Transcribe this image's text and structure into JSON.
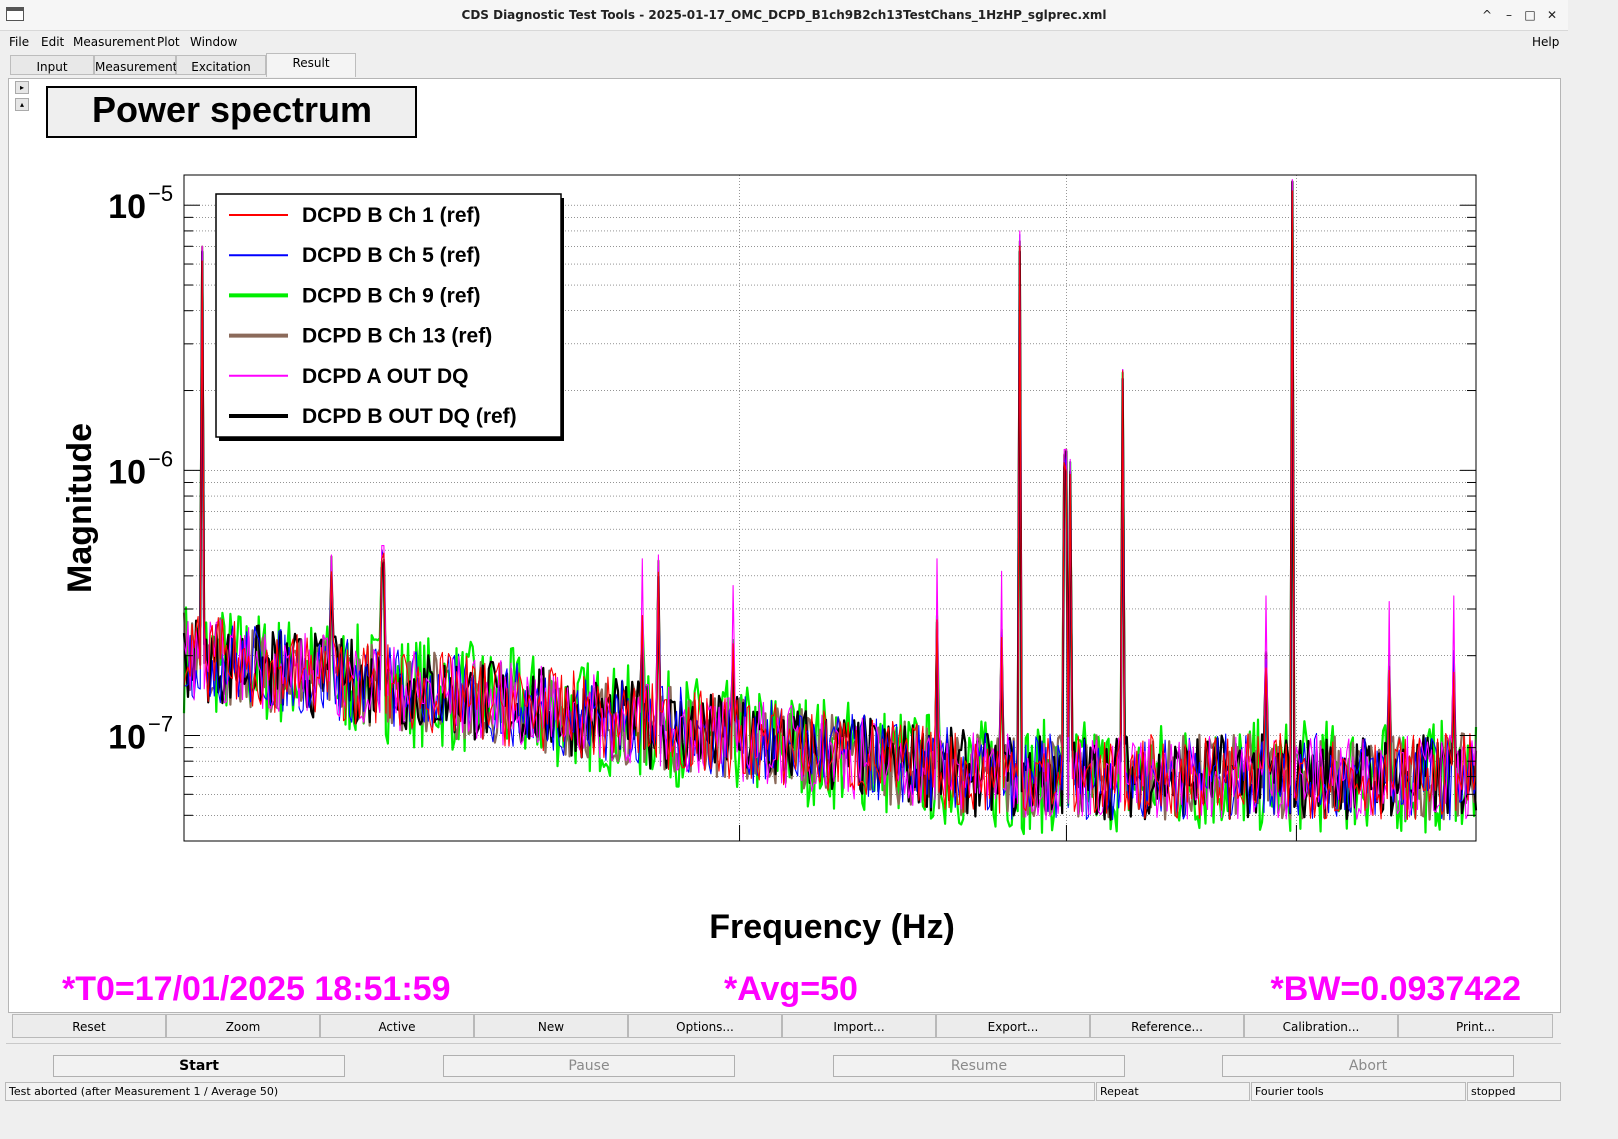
{
  "window": {
    "title": "CDS Diagnostic Test Tools - 2025-01-17_OMC_DCPD_B1ch9B2ch13TestChans_1HzHP_sglprec.xml",
    "controls": [
      "^",
      "–",
      "□",
      "✕"
    ]
  },
  "menu": {
    "items": [
      "File",
      "Edit",
      "Measurement",
      "Plot",
      "Window"
    ],
    "help": "Help"
  },
  "tabs": [
    {
      "label": "Input",
      "active": false
    },
    {
      "label": "Measurement",
      "active": false
    },
    {
      "label": "Excitation",
      "active": false
    },
    {
      "label": "Result",
      "active": true
    }
  ],
  "side_buttons": [
    "▸",
    "▴"
  ],
  "plot": {
    "title": "Power spectrum",
    "info": {
      "t0": "*T0=17/01/2025 18:51:59",
      "avg": "*Avg=50",
      "bw": "*BW=0.0937422"
    },
    "colors": {
      "info_text": "#ff00ff",
      "grid": "#555555"
    }
  },
  "chart_data": {
    "type": "line",
    "title": "Power spectrum",
    "xlabel": "Frequency (Hz)",
    "ylabel": "Magnitude",
    "yscale": "log",
    "ylim": [
      4e-08,
      1.3e-05
    ],
    "ytick_labels": [
      {
        "value": 1e-05,
        "mantissa": "10",
        "exp": "−5"
      },
      {
        "value": 1e-06,
        "mantissa": "10",
        "exp": "−6"
      },
      {
        "value": 1e-07,
        "mantissa": "10",
        "exp": "−7"
      }
    ],
    "grid": true,
    "legend_position": "top-left",
    "series": [
      {
        "name": "DCPD B Ch 1 (ref)",
        "color": "#ff0000",
        "style": "thin"
      },
      {
        "name": "DCPD B Ch 5 (ref)",
        "color": "#0000ff",
        "style": "thin"
      },
      {
        "name": "DCPD B Ch 9 (ref)",
        "color": "#00ee00",
        "style": "thick"
      },
      {
        "name": "DCPD B Ch 13 (ref)",
        "color": "#8b6a5a",
        "style": "thick"
      },
      {
        "name": "DCPD A OUT DQ",
        "color": "#ff00ff",
        "style": "thin"
      },
      {
        "name": "DCPD B OUT DQ (ref)",
        "color": "#000000",
        "style": "thick"
      }
    ],
    "noise_floor": {
      "start": 2e-07,
      "end": 7e-08
    },
    "peaks": [
      {
        "pos": 0.014,
        "value": 7e-06
      },
      {
        "pos": 0.114,
        "value": 4.8e-07
      },
      {
        "pos": 0.154,
        "value": 5.2e-07
      },
      {
        "pos": 0.355,
        "value": 2.9e-07
      },
      {
        "pos": 0.367,
        "value": 4.8e-07
      },
      {
        "pos": 0.425,
        "value": 2.3e-07
      },
      {
        "pos": 0.583,
        "value": 2.9e-07
      },
      {
        "pos": 0.633,
        "value": 2.6e-07
      },
      {
        "pos": 0.647,
        "value": 8e-06
      },
      {
        "pos": 0.682,
        "value": 1.2e-06
      },
      {
        "pos": 0.686,
        "value": 1.1e-06
      },
      {
        "pos": 0.726,
        "value": 2.4e-06
      },
      {
        "pos": 0.837,
        "value": 2.1e-07
      },
      {
        "pos": 0.858,
        "value": 1.25e-05
      },
      {
        "pos": 0.933,
        "value": 2e-07
      },
      {
        "pos": 0.983,
        "value": 2.1e-07
      }
    ]
  },
  "toolbar": {
    "buttons": [
      "Reset",
      "Zoom",
      "Active",
      "New",
      "Options...",
      "Import...",
      "Export...",
      "Reference...",
      "Calibration...",
      "Print..."
    ]
  },
  "controls": {
    "start": "Start",
    "pause": "Pause",
    "resume": "Resume",
    "abort": "Abort"
  },
  "status": {
    "message": "Test aborted (after Measurement 1 / Average 50)",
    "repeat": "Repeat",
    "tools": "Fourier tools",
    "state": "stopped"
  }
}
